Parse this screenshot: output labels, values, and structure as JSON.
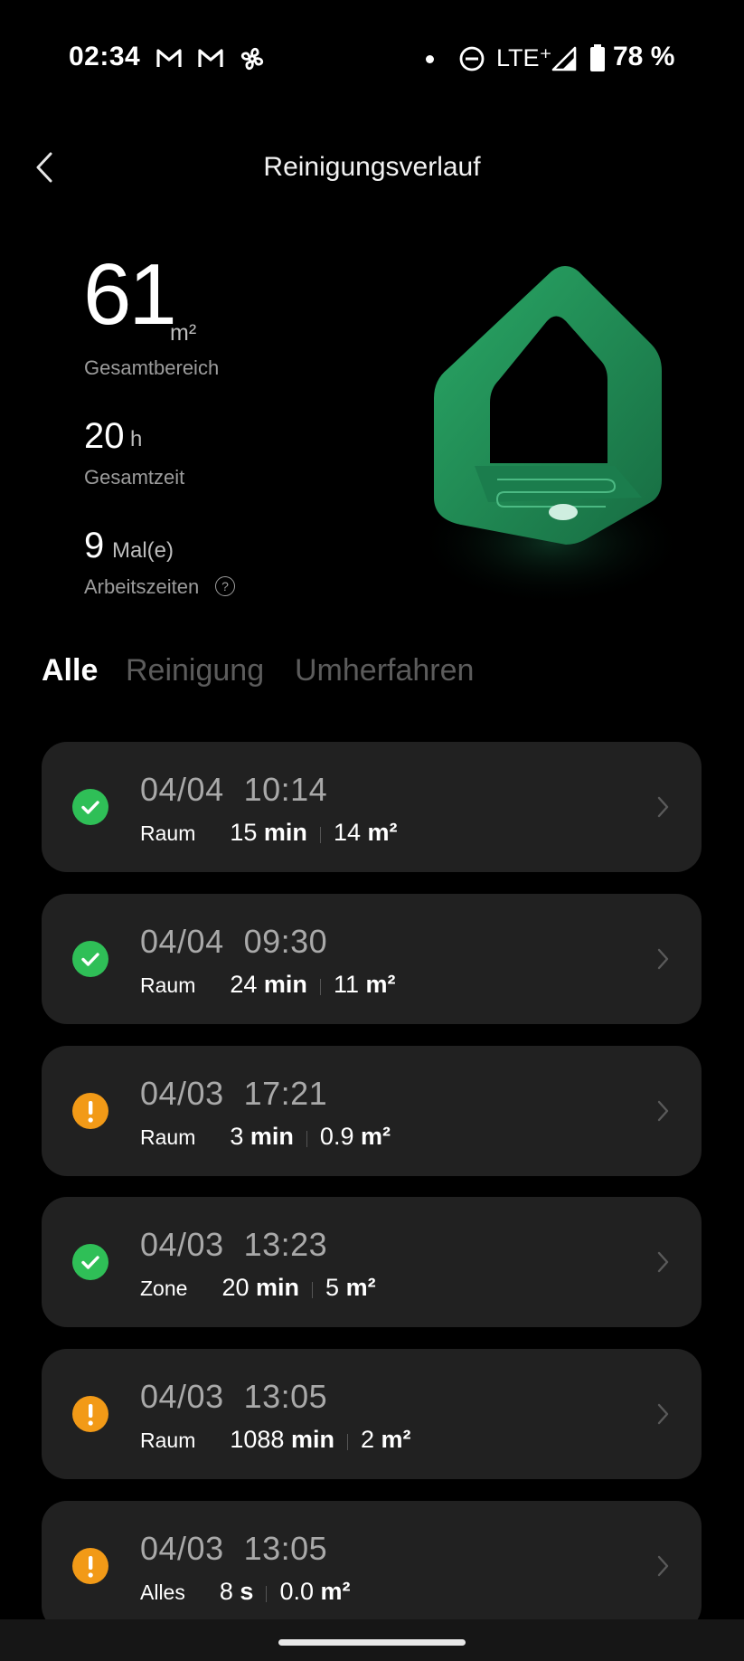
{
  "status_bar": {
    "time": "02:34",
    "network": "LTE⁺",
    "battery": "78 %",
    "icons": [
      "gmail-icon",
      "gmail-icon",
      "fan-icon",
      "dot-icon",
      "do-not-disturb-icon",
      "signal-icon",
      "battery-icon"
    ]
  },
  "header": {
    "title": "Reinigungsverlauf",
    "back_icon": "chevron-left-icon"
  },
  "stats": {
    "area": {
      "value": "61",
      "unit": "m²",
      "label": "Gesamtbereich"
    },
    "time": {
      "value": "20",
      "unit": "h",
      "label": "Gesamtzeit"
    },
    "count": {
      "value": "9",
      "unit": "Mal(e)",
      "label": "Arbeitszeiten"
    }
  },
  "tabs": [
    {
      "label": "Alle",
      "active": true
    },
    {
      "label": "Reinigung",
      "active": false
    },
    {
      "label": "Umherfahren",
      "active": false
    }
  ],
  "records": [
    {
      "date": "04/04",
      "time": "10:14",
      "mode": "Raum",
      "duration_value": "15",
      "duration_unit": "min",
      "area_value": "14",
      "area_unit": "m²",
      "status": "success"
    },
    {
      "date": "04/04",
      "time": "09:30",
      "mode": "Raum",
      "duration_value": "24",
      "duration_unit": "min",
      "area_value": "11",
      "area_unit": "m²",
      "status": "success"
    },
    {
      "date": "04/03",
      "time": "17:21",
      "mode": "Raum",
      "duration_value": "3",
      "duration_unit": "min",
      "area_value": "0.9",
      "area_unit": "m²",
      "status": "warning"
    },
    {
      "date": "04/03",
      "time": "13:23",
      "mode": "Zone",
      "duration_value": "20",
      "duration_unit": "min",
      "area_value": "5",
      "area_unit": "m²",
      "status": "success"
    },
    {
      "date": "04/03",
      "time": "13:05",
      "mode": "Raum",
      "duration_value": "1088",
      "duration_unit": "min",
      "area_value": "2",
      "area_unit": "m²",
      "status": "warning"
    },
    {
      "date": "04/03",
      "time": "13:05",
      "mode": "Alles",
      "duration_value": "8",
      "duration_unit": "s",
      "area_value": "0.0",
      "area_unit": "m²",
      "status": "warning"
    }
  ],
  "colors": {
    "success": "#2fbf57",
    "warning": "#f29a17",
    "card": "#212121",
    "house": "#1f8c57"
  }
}
